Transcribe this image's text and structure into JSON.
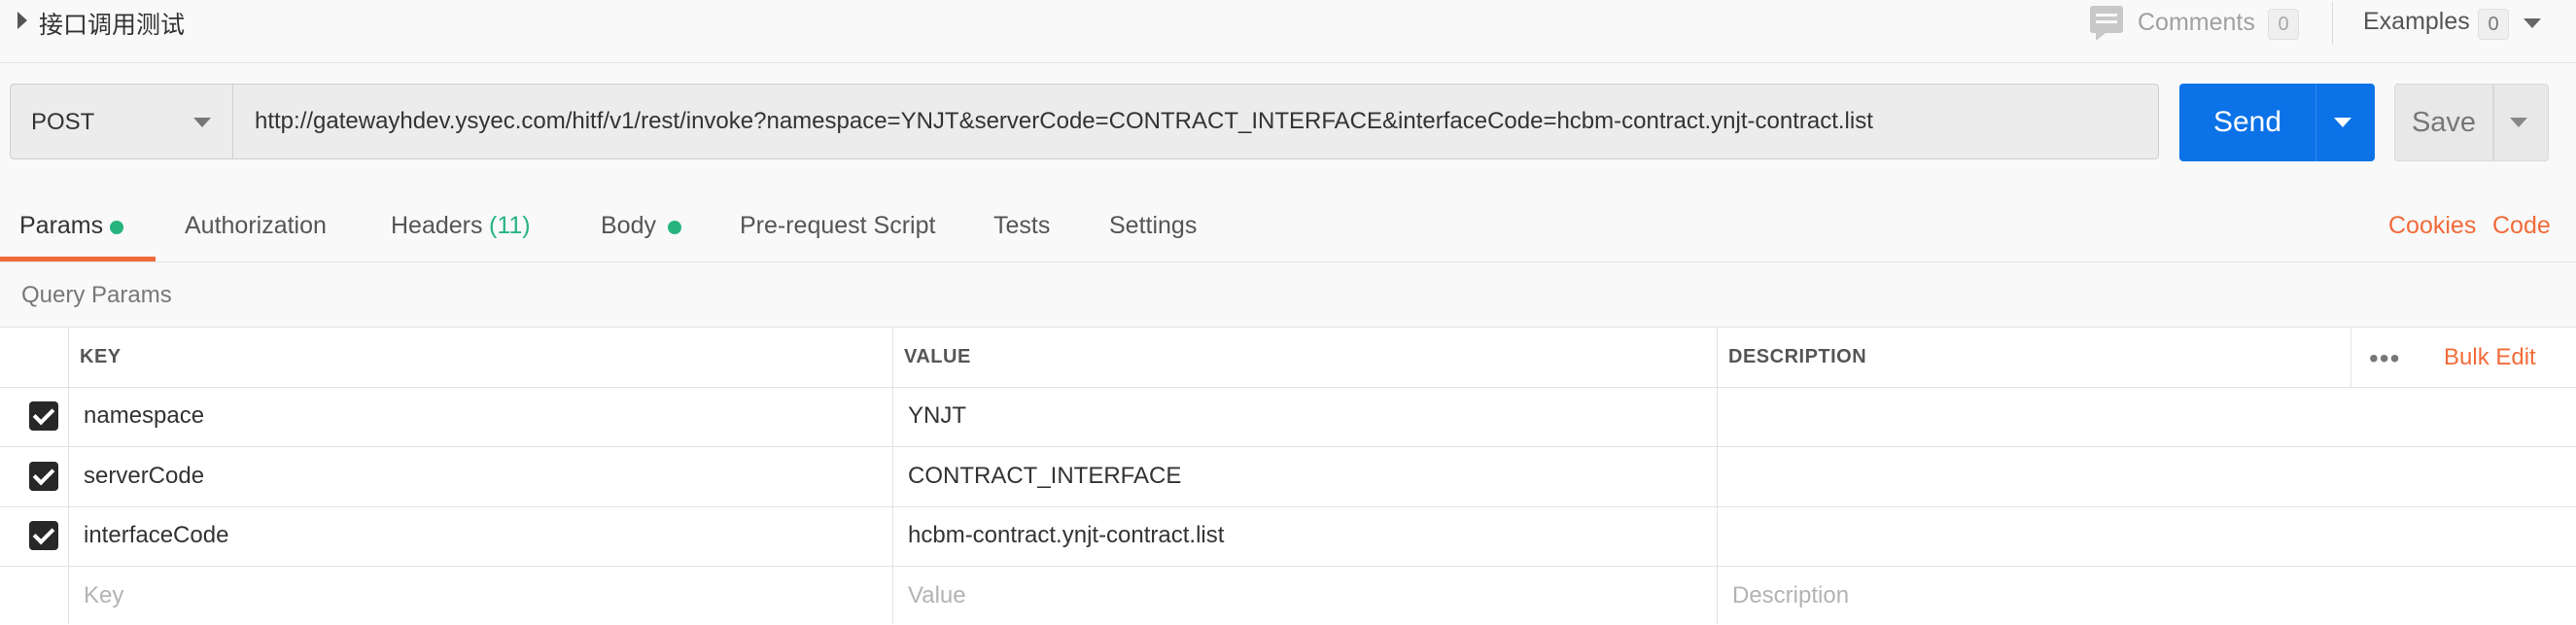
{
  "header": {
    "title": "接口调用测试",
    "comments_label": "Comments",
    "comments_count": "0",
    "examples_label": "Examples",
    "examples_count": "0"
  },
  "request": {
    "method": "POST",
    "url": "http://gatewayhdev.ysyec.com/hitf/v1/rest/invoke?namespace=YNJT&serverCode=CONTRACT_INTERFACE&interfaceCode=hcbm-contract.ynjt-contract.list",
    "send_label": "Send",
    "save_label": "Save"
  },
  "tabs": {
    "params": "Params",
    "authorization": "Authorization",
    "headers": "Headers",
    "headers_count": "(11)",
    "body": "Body",
    "prerequest": "Pre-request Script",
    "tests": "Tests",
    "settings": "Settings",
    "cookies": "Cookies",
    "code": "Code"
  },
  "query_params": {
    "title": "Query Params",
    "columns": {
      "key": "KEY",
      "value": "VALUE",
      "description": "DESCRIPTION"
    },
    "bulk_edit": "Bulk Edit",
    "more": "•••",
    "rows": [
      {
        "key": "namespace",
        "value": "YNJT",
        "checked": true
      },
      {
        "key": "serverCode",
        "value": "CONTRACT_INTERFACE",
        "checked": true
      },
      {
        "key": "interfaceCode",
        "value": "hcbm-contract.ynjt-contract.list",
        "checked": true
      }
    ],
    "placeholder": {
      "key": "Key",
      "value": "Value",
      "description": "Description"
    }
  },
  "colors": {
    "accent": "#f26b3a",
    "send": "#0b72e7",
    "status_green": "#26b47f"
  },
  "icons": [
    "caret-right-icon",
    "comment-icon",
    "chevron-down-icon",
    "checkbox-checked-icon",
    "more-icon"
  ]
}
